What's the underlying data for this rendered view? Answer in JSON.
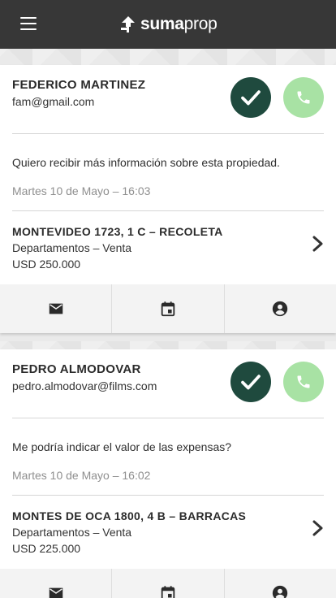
{
  "brand": {
    "logo_name": "sumaprop-logo",
    "bold": "suma",
    "light": "prop"
  },
  "colors": {
    "topbar": "#373737",
    "confirm": "#1f4a3e",
    "call": "#a8e2a4"
  },
  "inquiries": [
    {
      "name": "FEDERICO MARTINEZ",
      "email": "fam@gmail.com",
      "message": "Quiero recibir más información sobre esta propiedad.",
      "timestamp": "Martes 10 de Mayo – 16:03",
      "property": {
        "title": "MONTEVIDEO 1723, 1 C – RECOLETA",
        "type": "Departamentos – Venta",
        "price": "USD 250.000"
      }
    },
    {
      "name": "PEDRO ALMODOVAR",
      "email": "pedro.almodovar@films.com",
      "message": "Me podría indicar el valor de las expensas?",
      "timestamp": "Martes 10 de Mayo – 16:02",
      "property": {
        "title": "MONTES DE OCA 1800, 4 B – BARRACAS",
        "type": "Departamentos – Venta",
        "price": "USD 225.000"
      }
    }
  ],
  "icons": {
    "menu": "hamburger-icon",
    "confirm": "check-icon",
    "call": "phone-icon",
    "open": "chevron-right-icon",
    "email": "email-icon",
    "schedule": "calendar-icon",
    "profile": "account-circle-icon"
  }
}
